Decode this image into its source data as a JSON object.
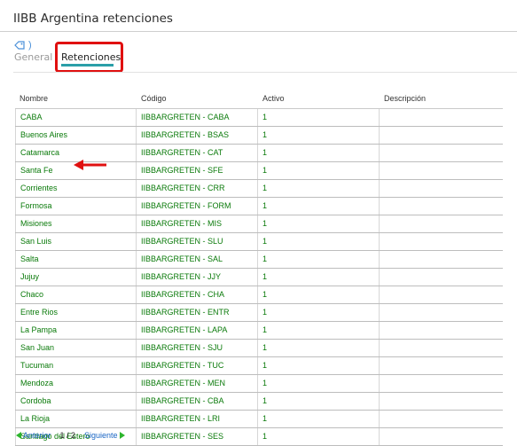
{
  "window": {
    "title": "IIBB Argentina retenciones"
  },
  "tabs": {
    "general": "General",
    "retenciones": "Retenciones",
    "chevron": ")"
  },
  "grid": {
    "columns": [
      "Nombre",
      "Código",
      "Activo",
      "Descripción"
    ],
    "rows": [
      {
        "nombre": "CABA",
        "codigo": "IIBBARGRETEN - CABA",
        "activo": "1",
        "descripcion": ""
      },
      {
        "nombre": "Buenos Aires",
        "codigo": "IIBBARGRETEN - BSAS",
        "activo": "1",
        "descripcion": ""
      },
      {
        "nombre": "Catamarca",
        "codigo": "IIBBARGRETEN - CAT",
        "activo": "1",
        "descripcion": ""
      },
      {
        "nombre": "Santa Fe",
        "codigo": "IIBBARGRETEN - SFE",
        "activo": "1",
        "descripcion": ""
      },
      {
        "nombre": "Corrientes",
        "codigo": "IIBBARGRETEN - CRR",
        "activo": "1",
        "descripcion": ""
      },
      {
        "nombre": "Formosa",
        "codigo": "IIBBARGRETEN - FORM",
        "activo": "1",
        "descripcion": ""
      },
      {
        "nombre": "Misiones",
        "codigo": "IIBBARGRETEN - MIS",
        "activo": "1",
        "descripcion": ""
      },
      {
        "nombre": "San Luis",
        "codigo": "IIBBARGRETEN - SLU",
        "activo": "1",
        "descripcion": ""
      },
      {
        "nombre": "Salta",
        "codigo": "IIBBARGRETEN - SAL",
        "activo": "1",
        "descripcion": ""
      },
      {
        "nombre": "Jujuy",
        "codigo": "IIBBARGRETEN - JJY",
        "activo": "1",
        "descripcion": ""
      },
      {
        "nombre": "Chaco",
        "codigo": "IIBBARGRETEN - CHA",
        "activo": "1",
        "descripcion": ""
      },
      {
        "nombre": "Entre Rios",
        "codigo": "IIBBARGRETEN - ENTR",
        "activo": "1",
        "descripcion": ""
      },
      {
        "nombre": "La Pampa",
        "codigo": "IIBBARGRETEN - LAPA",
        "activo": "1",
        "descripcion": ""
      },
      {
        "nombre": "San Juan",
        "codigo": "IIBBARGRETEN - SJU",
        "activo": "1",
        "descripcion": ""
      },
      {
        "nombre": "Tucuman",
        "codigo": "IIBBARGRETEN - TUC",
        "activo": "1",
        "descripcion": ""
      },
      {
        "nombre": "Mendoza",
        "codigo": "IIBBARGRETEN - MEN",
        "activo": "1",
        "descripcion": ""
      },
      {
        "nombre": "Cordoba",
        "codigo": "IIBBARGRETEN - CBA",
        "activo": "1",
        "descripcion": ""
      },
      {
        "nombre": "La Rioja",
        "codigo": "IIBBARGRETEN - LRI",
        "activo": "1",
        "descripcion": ""
      },
      {
        "nombre": "Santiago del Estero",
        "codigo": "IIBBARGRETEN - SES",
        "activo": "1",
        "descripcion": ""
      }
    ]
  },
  "pager": {
    "prev": "Anterior",
    "page": "1 / 2",
    "next": "Siguiente"
  },
  "colors": {
    "accent": "#2a9fa8",
    "highlight": "#e01010",
    "row_text": "#0a7a0a",
    "link": "#1a66c4"
  },
  "icons": {
    "tag": "tag-icon",
    "annotation_arrow": "arrow-left-icon"
  }
}
